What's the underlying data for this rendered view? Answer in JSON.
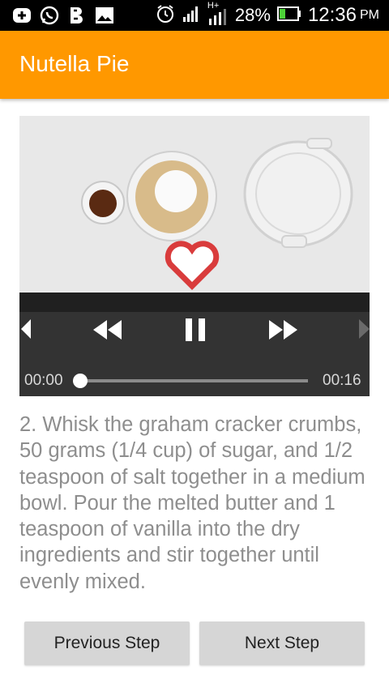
{
  "status_bar": {
    "battery": "28%",
    "time": "12:36",
    "ampm": "PM",
    "network": "H+",
    "icons": [
      "plus-box-icon",
      "whatsapp-icon",
      "b-app-icon",
      "image-icon",
      "alarm-icon",
      "signal-icon",
      "battery-icon"
    ]
  },
  "app_bar": {
    "title": "Nutella Pie",
    "color": "#ff9800"
  },
  "player": {
    "current_time": "00:00",
    "duration": "00:16",
    "progress": 0,
    "state": "playing"
  },
  "step": {
    "description": "2. Whisk the graham cracker crumbs, 50 grams (1/4 cup) of sugar, and 1/2 teaspoon of salt together in a medium bowl. Pour the melted butter and 1 teaspoon of vanilla into the dry ingredients and stir together until evenly mixed."
  },
  "buttons": {
    "previous": "Previous Step",
    "next": "Next Step"
  }
}
